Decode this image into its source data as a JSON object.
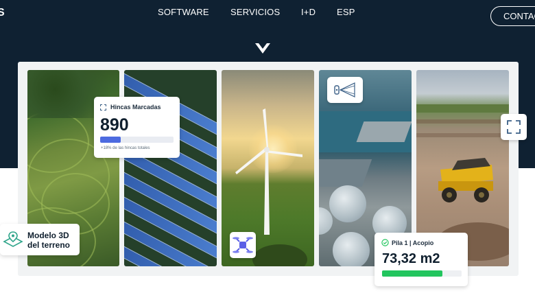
{
  "nav": {
    "logo_fragment": "S",
    "links": [
      "SOFTWARE",
      "SERVICIOS",
      "I+D",
      "ESP"
    ],
    "contact_label": "CONTACTO"
  },
  "colors": {
    "hero_background": "#0f2132",
    "accent_blue": "#4d6be0",
    "accent_green": "#22c55e",
    "icon_teal": "#2fa58a"
  },
  "icons": {
    "scroll": "chevron-down-icon",
    "scan": "laser-scanner-icon",
    "drone": "drone-icon",
    "expand": "expand-icon",
    "terrain": "map-pin-3d-icon",
    "hincas": "dashed-square-icon",
    "pila": "check-circle-icon"
  },
  "hincas_card": {
    "title": "Hincas Marcadas",
    "value": "890",
    "progress_fraction": 0.28,
    "note": "+18% de las hincas totales"
  },
  "modelo_card": {
    "line1": "Modelo 3D",
    "line2": "del terreno"
  },
  "pila_card": {
    "title": "Pila 1 | Acopio",
    "value": "73,32 m2",
    "progress_fraction": 0.76
  }
}
